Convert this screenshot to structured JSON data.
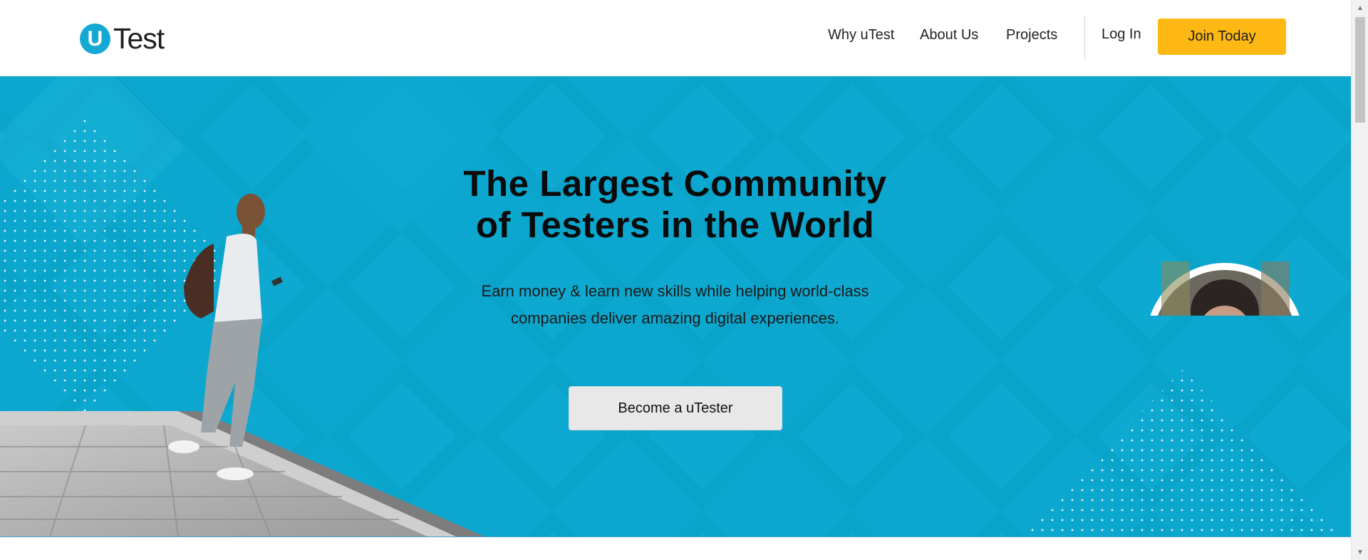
{
  "brand": {
    "logo_mark": "U",
    "logo_text": "Test"
  },
  "nav": {
    "items": [
      {
        "label": "Why uTest"
      },
      {
        "label": "About Us"
      },
      {
        "label": "Projects"
      }
    ],
    "login_label": "Log In",
    "join_label": "Join Today"
  },
  "hero": {
    "title_line1": "The Largest Community",
    "title_line2": "of Testers in the World",
    "subtitle_line1": "Earn money & learn new skills while helping world-class",
    "subtitle_line2": "companies deliver amazing digital experiences.",
    "cta_label": "Become a uTester"
  },
  "colors": {
    "hero_bg": "#0ca7cf",
    "accent_yellow": "#fdb813",
    "logo_blue": "#14a9d2"
  },
  "icons": {
    "scroll_up": "triangle-up-icon",
    "scroll_down": "triangle-down-icon"
  }
}
